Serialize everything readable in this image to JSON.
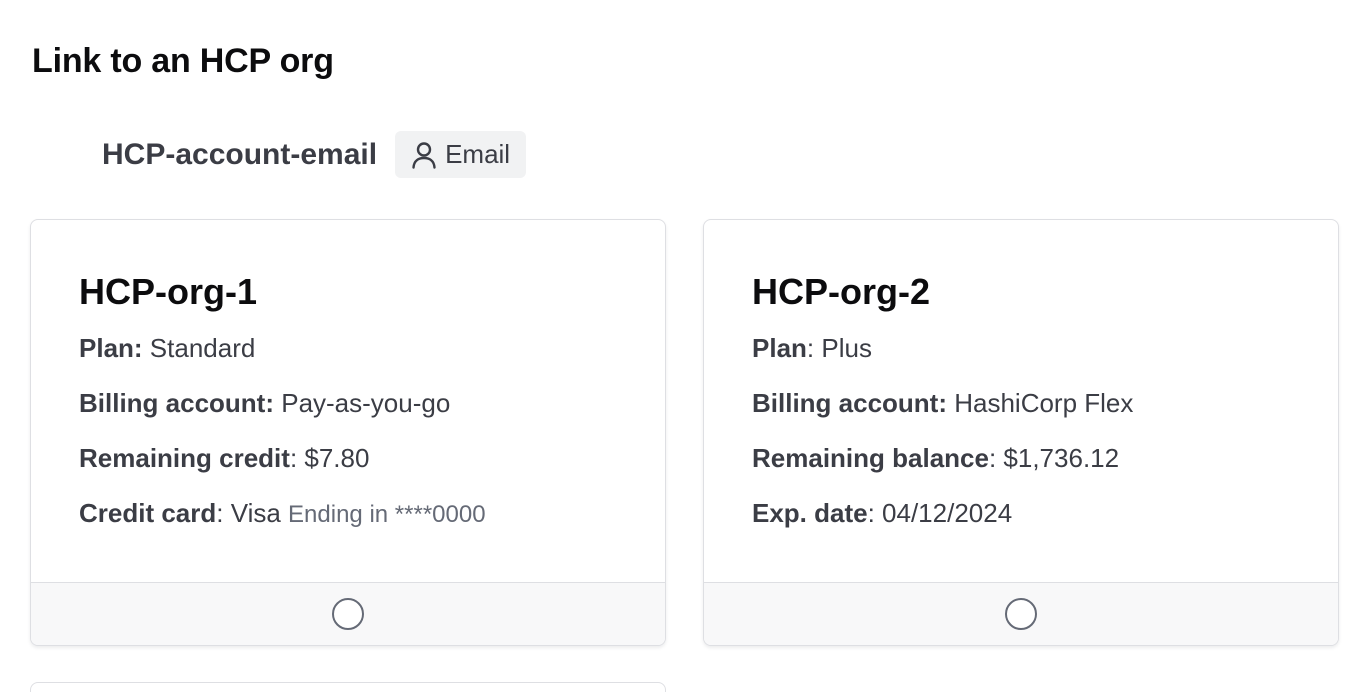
{
  "page": {
    "title": "Link to an HCP org"
  },
  "account": {
    "email": "HCP-account-email",
    "badge_icon": "user-icon",
    "badge_label": "Email"
  },
  "orgs": [
    {
      "name": "HCP-org-1",
      "details": [
        {
          "label": "Plan:",
          "value": " Standard",
          "extra": ""
        },
        {
          "label": "Billing account:",
          "value": " Pay-as-you-go",
          "extra": ""
        },
        {
          "label": "Remaining credit",
          "value": ": $7.80",
          "extra": ""
        },
        {
          "label": "Credit card",
          "value": ": Visa ",
          "extra": "Ending in ****0000"
        }
      ],
      "selected": false
    },
    {
      "name": "HCP-org-2",
      "details": [
        {
          "label": "Plan",
          "value": ": Plus",
          "extra": ""
        },
        {
          "label": "Billing account:",
          "value": " HashiCorp Flex",
          "extra": ""
        },
        {
          "label": "Remaining balance",
          "value": ": $1,736.12",
          "extra": ""
        },
        {
          "label": "Exp. date",
          "value": ": 04/12/2024",
          "extra": ""
        }
      ],
      "selected": false
    }
  ]
}
